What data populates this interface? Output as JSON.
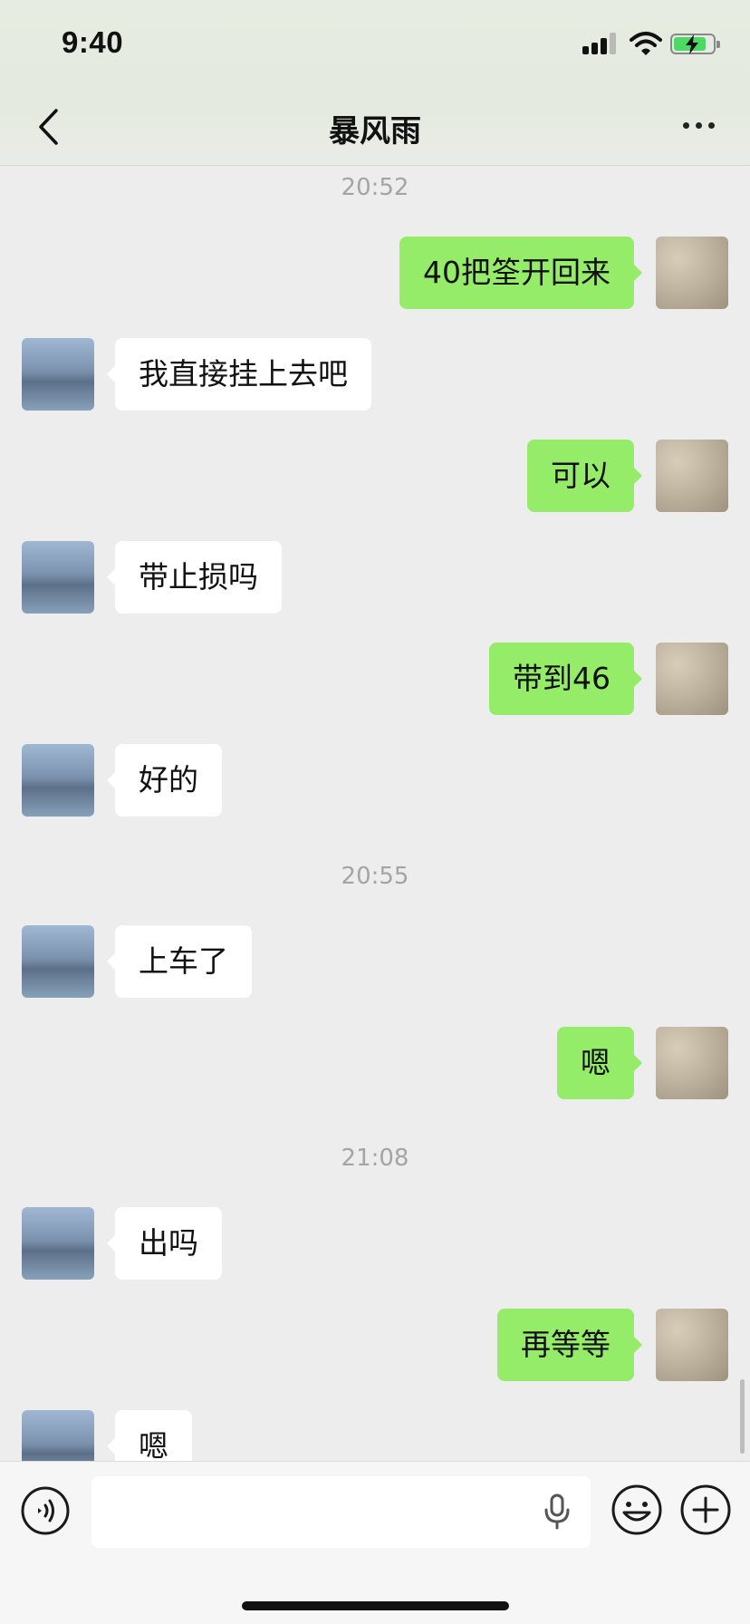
{
  "status_bar": {
    "time": "9:40"
  },
  "nav": {
    "title": "暴风雨"
  },
  "messages": [
    {
      "type": "time",
      "text": "20:52"
    },
    {
      "type": "msg",
      "side": "right",
      "text": "40把筌开回来"
    },
    {
      "type": "msg",
      "side": "left",
      "text": "我直接挂上去吧"
    },
    {
      "type": "msg",
      "side": "right",
      "text": "可以"
    },
    {
      "type": "msg",
      "side": "left",
      "text": "带止损吗"
    },
    {
      "type": "msg",
      "side": "right",
      "text": "带到46"
    },
    {
      "type": "msg",
      "side": "left",
      "text": "好的"
    },
    {
      "type": "time",
      "text": "20:55"
    },
    {
      "type": "msg",
      "side": "left",
      "text": "上车了"
    },
    {
      "type": "msg",
      "side": "right",
      "text": "嗯"
    },
    {
      "type": "time",
      "text": "21:08"
    },
    {
      "type": "msg",
      "side": "left",
      "text": "出吗"
    },
    {
      "type": "msg",
      "side": "right",
      "text": "再等等"
    },
    {
      "type": "msg",
      "side": "left",
      "text": "嗯"
    }
  ],
  "input": {
    "value": "",
    "placeholder": ""
  },
  "colors": {
    "sent_bubble": "#95ec69",
    "received_bubble": "#ffffff",
    "background": "#ededed",
    "timestamp": "#a4a4a4"
  },
  "icons": {
    "back": "chevron-left-icon",
    "more": "more-dots-icon",
    "voice": "voice-icon",
    "mic": "mic-icon",
    "emoji": "emoji-icon",
    "plus": "plus-icon",
    "signal": "signal-icon",
    "wifi": "wifi-icon",
    "battery": "battery-charging-icon"
  }
}
